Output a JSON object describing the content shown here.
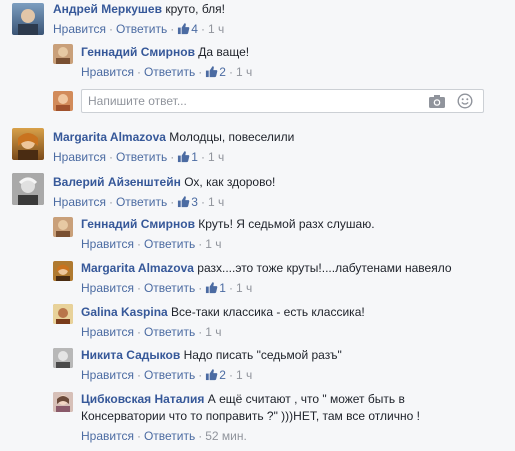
{
  "ui": {
    "like": "Нравится",
    "reply": "Ответить",
    "dot": "·"
  },
  "comments": [
    {
      "name": "Андрей Меркушев",
      "text": "круто, бля!",
      "likes": "4",
      "time": "1 ч"
    },
    {
      "name": "Геннадий Смирнов",
      "text": "Да ваще!",
      "likes": "2",
      "time": "1 ч"
    },
    {
      "name": "Margarita Almazova",
      "text": "Молодцы, повеселили",
      "likes": "1",
      "time": "1 ч"
    },
    {
      "name": "Валерий Айзенштейн",
      "text": "Ох, как здорово!",
      "likes": "3",
      "time": "1 ч"
    },
    {
      "name": "Геннадий Смирнов",
      "text": "Круть! Я седьмой разх слушаю.",
      "likes": "",
      "time": "1 ч"
    },
    {
      "name": "Margarita Almazova",
      "text": "разх....это тоже круты!....лабутенами навеяло",
      "likes": "1",
      "time": "1 ч"
    },
    {
      "name": "Galina Kaspina",
      "text": "Все-таки классика - есть классика!",
      "likes": "",
      "time": "1 ч"
    },
    {
      "name": "Никита Садыков",
      "text": "Надо писать \"седьмой разъ\"",
      "likes": "2",
      "time": "1 ч"
    },
    {
      "name": "Цибковская Наталия",
      "text": "А ещё считают , что \" может быть в",
      "text2": "Консерватории что то поправить ?\" )))НЕТ, там все отлично !",
      "likes": "",
      "time": "52 мин."
    }
  ],
  "reply_input": {
    "placeholder": "Напишите ответ..."
  },
  "icons": {
    "like": "thumbs-up-icon",
    "camera": "camera-icon",
    "emoji": "smiley-icon"
  },
  "colors": {
    "link": "#365899",
    "meta": "#90949c",
    "background": "#f6f7f9"
  }
}
